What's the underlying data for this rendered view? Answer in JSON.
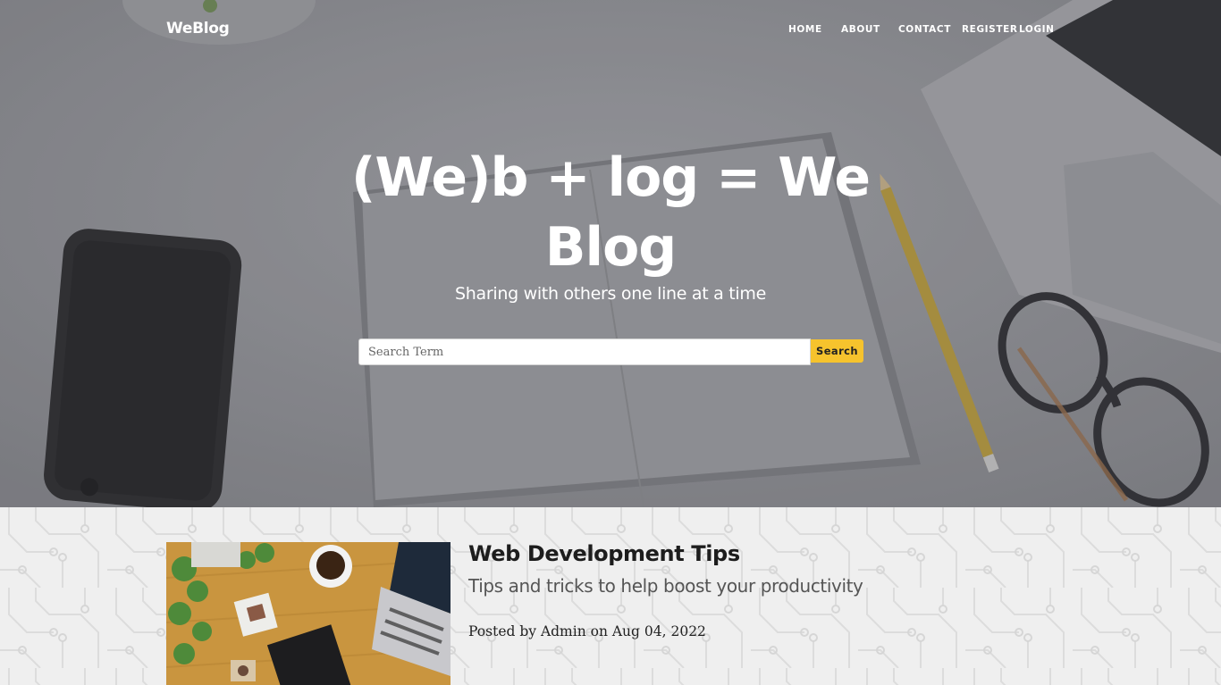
{
  "navbar": {
    "brand": "WeBlog",
    "links": {
      "home": "HOME",
      "about": "ABOUT",
      "contact": "CONTACT",
      "register": "REGISTER",
      "login": "LOGIN"
    }
  },
  "hero": {
    "title": "(We)b + log = We Blog",
    "subtitle": "Sharing with others one line at a time"
  },
  "search": {
    "placeholder": "Search Term",
    "value": "",
    "button_label": "Search"
  },
  "posts": [
    {
      "title": "Web Development Tips",
      "subtitle": "Tips and tricks to help boost your productivity",
      "meta": "Posted by Admin on Aug 04, 2022"
    }
  ],
  "colors": {
    "accent": "#f6c32d",
    "hero_overlay": "#8d8e93",
    "section_bg": "#eeeeee"
  }
}
